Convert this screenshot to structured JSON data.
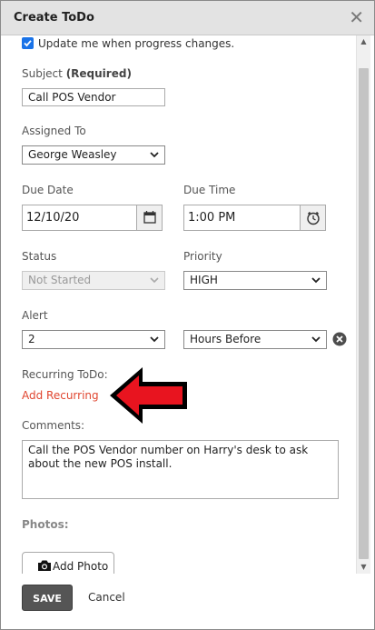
{
  "dialog": {
    "title": "Create ToDo",
    "close_glyph": "✕"
  },
  "form": {
    "notify_checkbox": {
      "label": "Update me when progress changes.",
      "checked": true
    },
    "subject": {
      "label": "Subject",
      "required_note": "(Required)",
      "value": "Call POS Vendor"
    },
    "assigned_to": {
      "label": "Assigned To",
      "value": "George Weasley"
    },
    "due_date": {
      "label": "Due Date",
      "value": "12/10/20",
      "icon": "calendar-icon"
    },
    "due_time": {
      "label": "Due Time",
      "value": "1:00 PM",
      "icon": "alarm-clock-icon"
    },
    "status": {
      "label": "Status",
      "value": "Not Started",
      "disabled": true
    },
    "priority": {
      "label": "Priority",
      "value": "HIGH"
    },
    "alert": {
      "label": "Alert",
      "amount": "2",
      "unit": "Hours Before",
      "clear_icon": "clear-x-icon"
    },
    "recurring": {
      "label": "Recurring ToDo:",
      "link": "Add Recurring"
    },
    "comments": {
      "label": "Comments:",
      "value": "Call the POS Vendor number on Harry's desk to ask about the new POS install."
    },
    "photos": {
      "label": "Photos:",
      "button": "Add Photo",
      "icon": "camera-icon"
    }
  },
  "footer": {
    "save": "SAVE",
    "cancel": "Cancel"
  },
  "annotation": {
    "icon": "red-arrow-icon",
    "color": "#e8141f"
  },
  "colors": {
    "link": "#e0452f",
    "save_bg": "#555555",
    "titlebar": "#e3e3e3"
  }
}
